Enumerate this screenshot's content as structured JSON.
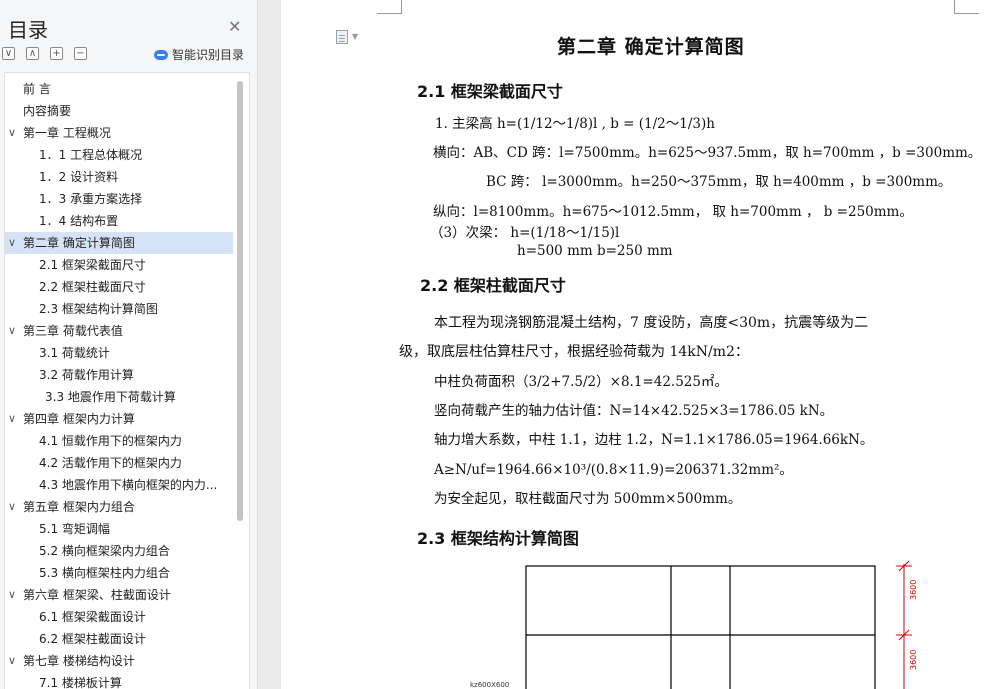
{
  "sidebar": {
    "title": "目录",
    "smart_toc_label": "智能识别目录",
    "controls": [
      "∨",
      "∧",
      "+",
      "−"
    ],
    "items": [
      {
        "label": "前    言",
        "level": 0,
        "arrow": false
      },
      {
        "label": "内容摘要",
        "level": 0,
        "arrow": false
      },
      {
        "label": "第一章    工程概况",
        "level": 0,
        "arrow": true
      },
      {
        "label": "1．1  工程总体概况",
        "level": 1,
        "arrow": false
      },
      {
        "label": "1．2  设计资料",
        "level": 1,
        "arrow": false
      },
      {
        "label": "1．3  承重方案选择",
        "level": 1,
        "arrow": false
      },
      {
        "label": "1．4  结构布置",
        "level": 1,
        "arrow": false
      },
      {
        "label": "第二章      确定计算简图",
        "level": 0,
        "arrow": true,
        "selected": true
      },
      {
        "label": "2.1  框架梁截面尺寸",
        "level": 1,
        "arrow": false
      },
      {
        "label": "2.2  框架柱截面尺寸",
        "level": 1,
        "arrow": false
      },
      {
        "label": "2.3  框架结构计算简图",
        "level": 1,
        "arrow": false
      },
      {
        "label": "第三章    荷载代表值",
        "level": 0,
        "arrow": true
      },
      {
        "label": "3.1 荷载统计",
        "level": 1,
        "arrow": false
      },
      {
        "label": "3.2  荷载作用计算",
        "level": 1,
        "arrow": false
      },
      {
        "label": "3.3  地震作用下荷载计算",
        "level": 2,
        "arrow": false
      },
      {
        "label": "第四章      框架内力计算",
        "level": 0,
        "arrow": true
      },
      {
        "label": "4.1  恒载作用下的框架内力",
        "level": 1,
        "arrow": false
      },
      {
        "label": "4.2  活载作用下的框架内力",
        "level": 1,
        "arrow": false
      },
      {
        "label": "4.3 地震作用下横向框架的内力...",
        "level": 1,
        "arrow": false
      },
      {
        "label": "第五章      框架内力组合",
        "level": 0,
        "arrow": true
      },
      {
        "label": "5.1  弯矩调幅",
        "level": 1,
        "arrow": false
      },
      {
        "label": "5.2 横向框架梁内力组合",
        "level": 1,
        "arrow": false
      },
      {
        "label": "5.3 横向框架柱内力组合",
        "level": 1,
        "arrow": false
      },
      {
        "label": "第六章      框架梁、柱截面设计",
        "level": 0,
        "arrow": true
      },
      {
        "label": "6.1 框架梁截面设计",
        "level": 1,
        "arrow": false
      },
      {
        "label": "6.2  框架柱截面设计",
        "level": 1,
        "arrow": false
      },
      {
        "label": "第七章    楼梯结构设计",
        "level": 0,
        "arrow": true
      },
      {
        "label": "7.1  楼梯板计算",
        "level": 1,
        "arrow": false
      }
    ]
  },
  "document": {
    "chapter_title": "第二章      确定计算简图",
    "s21_title": "2.1  框架梁截面尺寸",
    "s21_lines": [
      "1. 主梁高  h=(1/12～1/8)l  ,   b = (1/2～1/3)h",
      "横向：AB、CD 跨：l=7500mm。h=625～937.5mm，取 h=700mm ，b =300mm。",
      "BC 跨：     l=3000mm。h=250～375mm，取 h=400mm ，b =300mm。",
      "纵向：l=8100mm。h=675～1012.5mm，  取 h=700mm  ，  b  =250mm。",
      "（3）次梁：  h=(1/18～1/15)l",
      "h=500  mm   b=250  mm"
    ],
    "s22_title": "2.2  框架柱截面尺寸",
    "s22_lines": [
      "本工程为现浇钢筋混凝土结构，7 度设防，高度<30m，抗震等级为二",
      "级，取底层柱估算柱尺寸，根据经验荷载为 14kN/m2：",
      "中柱负荷面积（3/2+7.5/2）×8.1=42.525㎡。",
      "竖向荷载产生的轴力估计值：N=14×42.525×3=1786.05  kN。",
      "轴力增大系数，中柱 1.1，边柱 1.2，N=1.1×1786.05=1964.66kN。",
      "A≥N/uf=1964.66×10³/(0.8×11.9)=206371.32mm²。",
      "为安全起见，取柱截面尺寸为 500mm×500mm。"
    ],
    "s23_title": "2.3  框架结构计算简图",
    "drawing_labels": {
      "dim_top": "3600",
      "dim_mid": "3600",
      "column": "kz600X600"
    }
  },
  "colors": {
    "selected_bg": "#d6e3f7",
    "dim_red": "#d40000",
    "accent": "#3c7ce8"
  }
}
